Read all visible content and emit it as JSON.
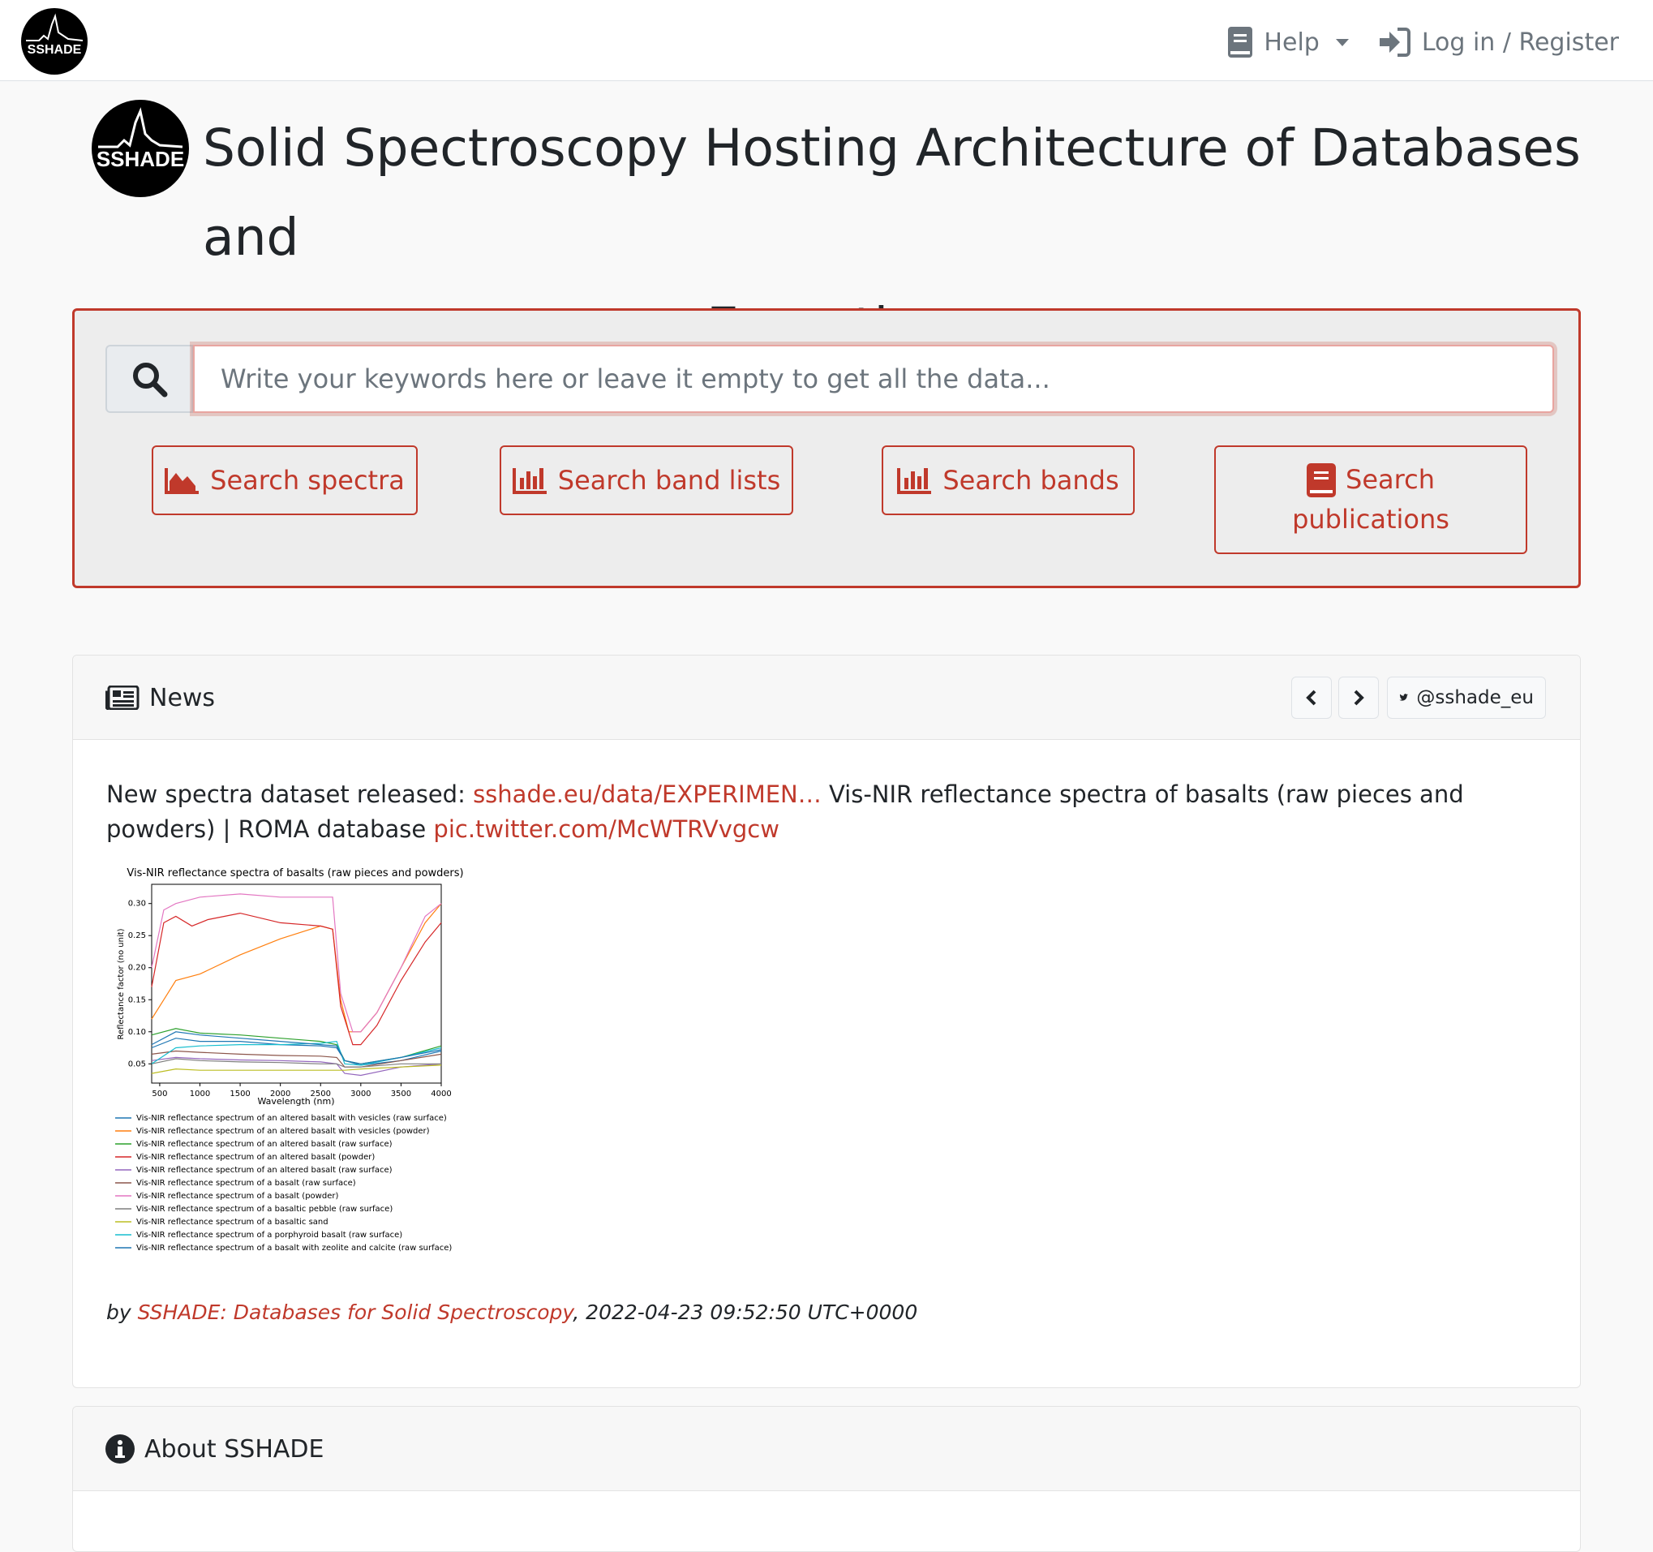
{
  "nav": {
    "logo_text": "SSHADE",
    "help_label": "Help",
    "login_label": "Log in / Register"
  },
  "hero": {
    "logo_text": "SSHADE",
    "title_line1": "Solid Spectroscopy Hosting Architecture of Databases and",
    "title_line2": "Expertise"
  },
  "search": {
    "placeholder": "Write your keywords here or leave it empty to get all the data...",
    "buttons": {
      "spectra": "Search spectra",
      "band_lists": "Search band lists",
      "bands": "Search bands",
      "publications_l1": "Search",
      "publications_l2": "publications"
    }
  },
  "news": {
    "title": "News",
    "twitter_handle": "@sshade_eu",
    "prev_icon": "chevron-left-icon",
    "next_icon": "chevron-right-icon",
    "text_prefix": "New spectra dataset released: ",
    "link1": "sshade.eu/data/EXPERIMEN…",
    "text_middle": " Vis-NIR reflectance spectra of basalts (raw pieces and powders) | ROMA database ",
    "link2": "pic.twitter.com/McWTRVvgcw",
    "by_label": "by ",
    "author": "SSHADE: Databases for Solid Spectroscopy",
    "timestamp": ", 2022-04-23 09:52:50 UTC+0000"
  },
  "about": {
    "title": "About SSHADE"
  },
  "colors": {
    "accent": "#c0392b"
  },
  "chart_data": {
    "type": "line",
    "title": "Vis-NIR reflectance spectra of basalts (raw pieces and powders)",
    "xlabel": "Wavelength (nm)",
    "ylabel": "Reflectance factor (no unit)",
    "xlim": [
      400,
      4000
    ],
    "ylim": [
      0.02,
      0.33
    ],
    "xticks": [
      500,
      1000,
      1500,
      2000,
      2500,
      3000,
      3500,
      4000
    ],
    "yticks": [
      0.05,
      0.1,
      0.15,
      0.2,
      0.25,
      0.3
    ],
    "legend_position": "below",
    "series": [
      {
        "name": "Vis-NIR reflectance spectrum of an altered basalt with vesicles (raw surface)",
        "color": "#1f77b4",
        "x": [
          400,
          700,
          1000,
          1500,
          2000,
          2500,
          2700,
          2800,
          3000,
          3500,
          4000
        ],
        "y": [
          0.075,
          0.09,
          0.085,
          0.085,
          0.08,
          0.078,
          0.075,
          0.055,
          0.048,
          0.055,
          0.07
        ]
      },
      {
        "name": "Vis-NIR reflectance spectrum of an altered basalt with vesicles (powder)",
        "color": "#ff7f0e",
        "x": [
          400,
          550,
          700,
          1000,
          1500,
          2000,
          2500,
          2650,
          2750,
          2850,
          3000,
          3200,
          3500,
          3800,
          4000
        ],
        "y": [
          0.12,
          0.15,
          0.18,
          0.19,
          0.22,
          0.245,
          0.265,
          0.26,
          0.15,
          0.1,
          0.1,
          0.13,
          0.2,
          0.27,
          0.3
        ]
      },
      {
        "name": "Vis-NIR reflectance spectrum of an altered basalt (raw surface)",
        "color": "#2ca02c",
        "x": [
          400,
          700,
          1000,
          1500,
          2000,
          2500,
          2700,
          2800,
          3000,
          3500,
          4000
        ],
        "y": [
          0.095,
          0.105,
          0.098,
          0.095,
          0.09,
          0.085,
          0.08,
          0.055,
          0.05,
          0.06,
          0.078
        ]
      },
      {
        "name": "Vis-NIR reflectance spectrum of an altered basalt (powder)",
        "color": "#d62728",
        "x": [
          400,
          550,
          700,
          900,
          1100,
          1500,
          2000,
          2500,
          2650,
          2750,
          2900,
          3000,
          3200,
          3500,
          3800,
          4000
        ],
        "y": [
          0.17,
          0.27,
          0.28,
          0.265,
          0.275,
          0.285,
          0.27,
          0.265,
          0.26,
          0.14,
          0.08,
          0.08,
          0.11,
          0.18,
          0.24,
          0.27
        ]
      },
      {
        "name": "Vis-NIR reflectance spectrum of an altered basalt (raw surface)",
        "color": "#9467bd",
        "x": [
          400,
          700,
          1000,
          1500,
          2000,
          2500,
          2700,
          2800,
          3000,
          3500,
          4000
        ],
        "y": [
          0.055,
          0.06,
          0.058,
          0.056,
          0.055,
          0.053,
          0.05,
          0.035,
          0.032,
          0.045,
          0.05
        ]
      },
      {
        "name": "Vis-NIR reflectance spectrum of a basalt (raw surface)",
        "color": "#8c564b",
        "x": [
          400,
          700,
          1000,
          1500,
          2000,
          2500,
          2700,
          2800,
          3000,
          3500,
          4000
        ],
        "y": [
          0.065,
          0.07,
          0.068,
          0.065,
          0.063,
          0.062,
          0.06,
          0.045,
          0.045,
          0.055,
          0.065
        ]
      },
      {
        "name": "Vis-NIR reflectance spectrum of a basalt (powder)",
        "color": "#e377c2",
        "x": [
          400,
          550,
          700,
          1000,
          1500,
          2000,
          2500,
          2650,
          2750,
          2900,
          3000,
          3200,
          3500,
          3800,
          4000
        ],
        "y": [
          0.2,
          0.29,
          0.3,
          0.31,
          0.315,
          0.31,
          0.31,
          0.31,
          0.16,
          0.1,
          0.1,
          0.13,
          0.2,
          0.28,
          0.3
        ]
      },
      {
        "name": "Vis-NIR reflectance spectrum of a basaltic pebble (raw surface)",
        "color": "#7f7f7f",
        "x": [
          400,
          700,
          1000,
          1500,
          2000,
          2500,
          2700,
          2800,
          3000,
          3500,
          4000
        ],
        "y": [
          0.05,
          0.058,
          0.055,
          0.053,
          0.052,
          0.05,
          0.05,
          0.045,
          0.045,
          0.05,
          0.05
        ]
      },
      {
        "name": "Vis-NIR reflectance spectrum of a basaltic sand",
        "color": "#bcbd22",
        "x": [
          400,
          700,
          1000,
          1500,
          2000,
          2500,
          2700,
          2800,
          3000,
          3500,
          4000
        ],
        "y": [
          0.035,
          0.042,
          0.04,
          0.04,
          0.04,
          0.04,
          0.04,
          0.04,
          0.042,
          0.045,
          0.048
        ]
      },
      {
        "name": "Vis-NIR reflectance spectrum of a porphyroid basalt (raw surface)",
        "color": "#17becf",
        "x": [
          400,
          700,
          1000,
          1500,
          2000,
          2500,
          2700,
          2800,
          3000,
          3500,
          4000
        ],
        "y": [
          0.05,
          0.075,
          0.078,
          0.08,
          0.08,
          0.082,
          0.085,
          0.05,
          0.048,
          0.06,
          0.075
        ]
      },
      {
        "name": "Vis-NIR reflectance spectrum of a basalt with zeolite and calcite (raw surface)",
        "color": "#1f77b4",
        "x": [
          400,
          700,
          1000,
          1500,
          2000,
          2500,
          2700,
          2800,
          3000,
          3500,
          4000
        ],
        "y": [
          0.08,
          0.1,
          0.095,
          0.09,
          0.085,
          0.08,
          0.078,
          0.055,
          0.05,
          0.06,
          0.072
        ]
      }
    ]
  }
}
